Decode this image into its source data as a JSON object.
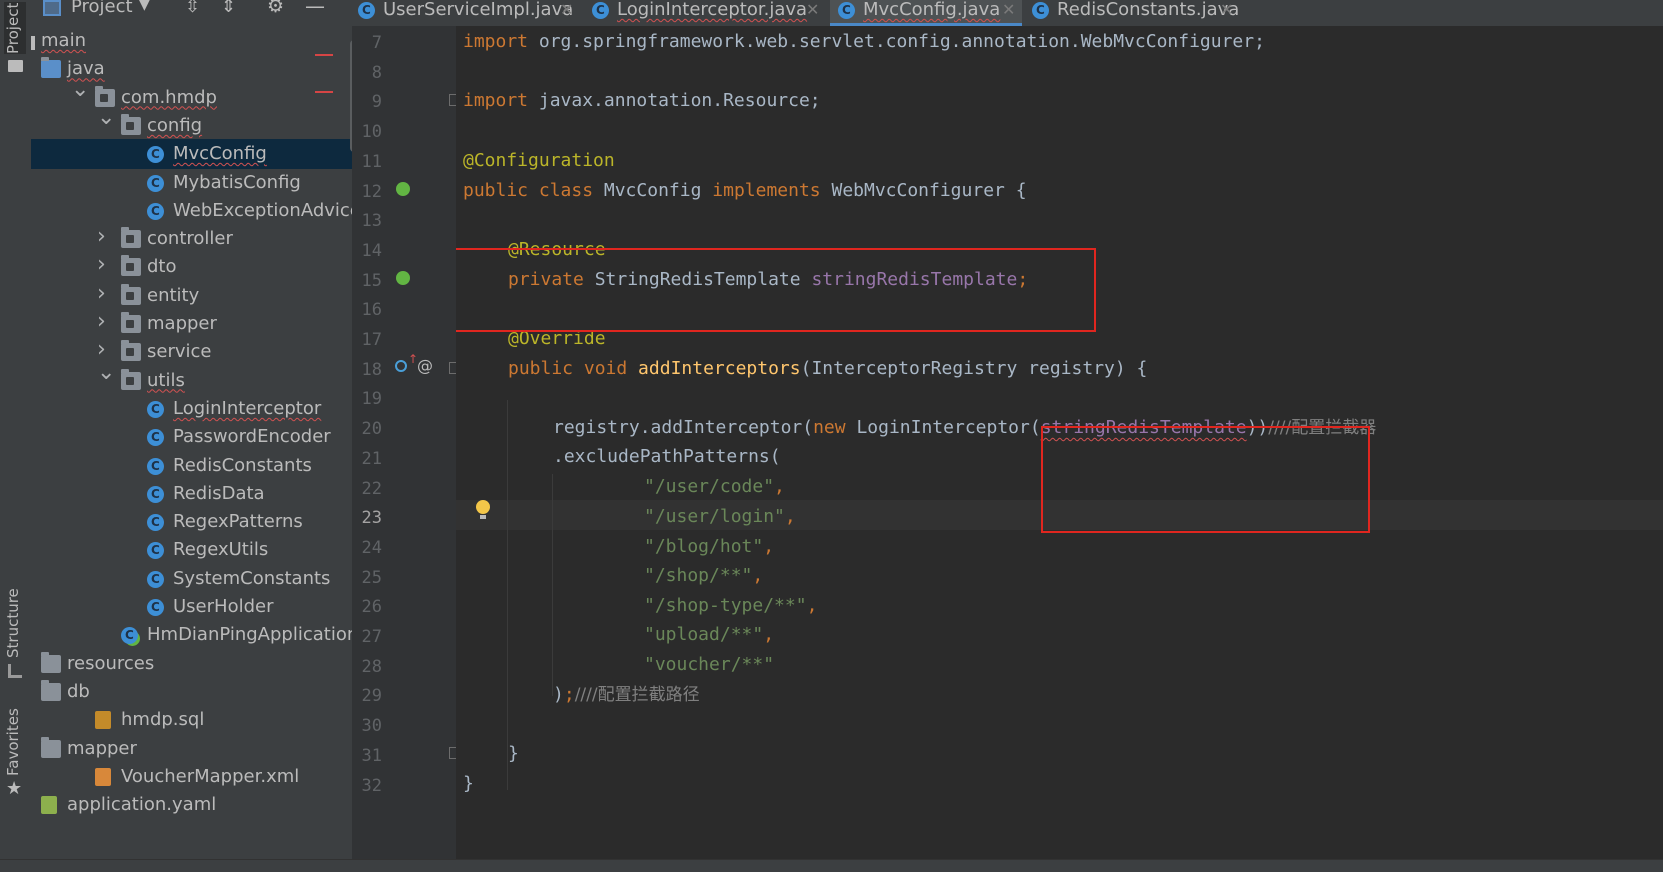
{
  "sidebar_tabs": {
    "project": "Project",
    "structure": "Structure",
    "favorites": "Favorites"
  },
  "project_panel": {
    "title": "Project",
    "tree": [
      {
        "label": "main",
        "icon": "folder-icon",
        "squiggle": true
      },
      {
        "label": "java",
        "icon": "source-folder-icon",
        "squiggle": true
      },
      {
        "label": "com.hmdp",
        "icon": "package-icon",
        "squiggle": true
      },
      {
        "label": "config",
        "icon": "package-icon",
        "squiggle": true
      },
      {
        "label": "MvcConfig",
        "icon": "class-icon",
        "squiggle": true
      },
      {
        "label": "MybatisConfig",
        "icon": "class-icon"
      },
      {
        "label": "WebExceptionAdvice",
        "icon": "class-icon"
      },
      {
        "label": "controller",
        "icon": "package-icon"
      },
      {
        "label": "dto",
        "icon": "package-icon"
      },
      {
        "label": "entity",
        "icon": "package-icon"
      },
      {
        "label": "mapper",
        "icon": "package-icon"
      },
      {
        "label": "service",
        "icon": "package-icon"
      },
      {
        "label": "utils",
        "icon": "package-icon",
        "squiggle": true
      },
      {
        "label": "LoginInterceptor",
        "icon": "class-icon",
        "squiggle": true
      },
      {
        "label": "PasswordEncoder",
        "icon": "class-icon"
      },
      {
        "label": "RedisConstants",
        "icon": "class-icon"
      },
      {
        "label": "RedisData",
        "icon": "class-icon"
      },
      {
        "label": "RegexPatterns",
        "icon": "class-icon"
      },
      {
        "label": "RegexUtils",
        "icon": "class-icon"
      },
      {
        "label": "SystemConstants",
        "icon": "class-icon"
      },
      {
        "label": "UserHolder",
        "icon": "class-icon"
      },
      {
        "label": "HmDianPingApplication",
        "icon": "spring-app-icon"
      },
      {
        "label": "resources",
        "icon": "resources-folder-icon"
      },
      {
        "label": "db",
        "icon": "folder-icon"
      },
      {
        "label": "hmdp.sql",
        "icon": "sql-file-icon"
      },
      {
        "label": "mapper",
        "icon": "folder-icon"
      },
      {
        "label": "VoucherMapper.xml",
        "icon": "xml-file-icon"
      },
      {
        "label": "application.yaml",
        "icon": "yaml-file-icon"
      }
    ]
  },
  "tabs": [
    {
      "label": "UserServiceImpl.java",
      "active": false
    },
    {
      "label": "LoginInterceptor.java",
      "active": false
    },
    {
      "label": "MvcConfig.java",
      "active": true
    },
    {
      "label": "RedisConstants.java",
      "active": false
    }
  ],
  "editor": {
    "current_line": "23",
    "line_numbers": [
      "7",
      "8",
      "9",
      "10",
      "11",
      "12",
      "13",
      "14",
      "15",
      "16",
      "17",
      "18",
      "19",
      "20",
      "21",
      "22",
      "23",
      "24",
      "25",
      "26",
      "27",
      "28",
      "29",
      "30",
      "31",
      "32"
    ],
    "code": {
      "l7_kw": "import",
      "l7_rest": " org.springframework.web.servlet.config.annotation.WebMvcConfigurer;",
      "l9_kw": "import",
      "l9_rest": " javax.annotation.Resource;",
      "l11_ann": "@Configuration",
      "l12_kw1": "public class",
      "l12_name": " MvcConfig ",
      "l12_kw2": "implements",
      "l12_rest": " WebMvcConfigurer {",
      "l14_ann": "@Resource",
      "l15_kw": "private",
      "l15_type": " StringRedisTemplate ",
      "l15_field": "stringRedisTemplate",
      "l15_end": ";",
      "l17_ann": "@Override",
      "l18_kw": "public void",
      "l18_method": " addInterceptors",
      "l18_rest": "(InterceptorRegistry registry) {",
      "l20_a": "registry.addInterceptor(",
      "l20_kw": "new",
      "l20_b": " LoginInterceptor(",
      "l20_field": "stringRedisTemplate",
      "l20_c": "))",
      "l20_cmt": "////配置拦截器",
      "l21": ".excludePathPatterns(",
      "l22_str": "\"/user/code\"",
      "l23_str": "\"/user/login\"",
      "l24_str": "\"/blog/hot\"",
      "l25_str": "\"/shop/**\"",
      "l26_str": "\"/shop-type/**\"",
      "l27_str": "\"upload/**\"",
      "l28_str": "\"voucher/**\"",
      "l29_a": ")",
      "l29_semi": ";",
      "l29_cmt": "////配置拦截路径",
      "l31": "}",
      "l32": "}"
    },
    "comma": ","
  },
  "colors": {
    "keyword": "#cc7832",
    "annotation": "#bbb529",
    "field": "#9876aa",
    "string": "#6a8759",
    "method": "#ffc66d",
    "comment": "#808080",
    "highlight_box": "#e0261f",
    "selection": "#0d293e"
  }
}
